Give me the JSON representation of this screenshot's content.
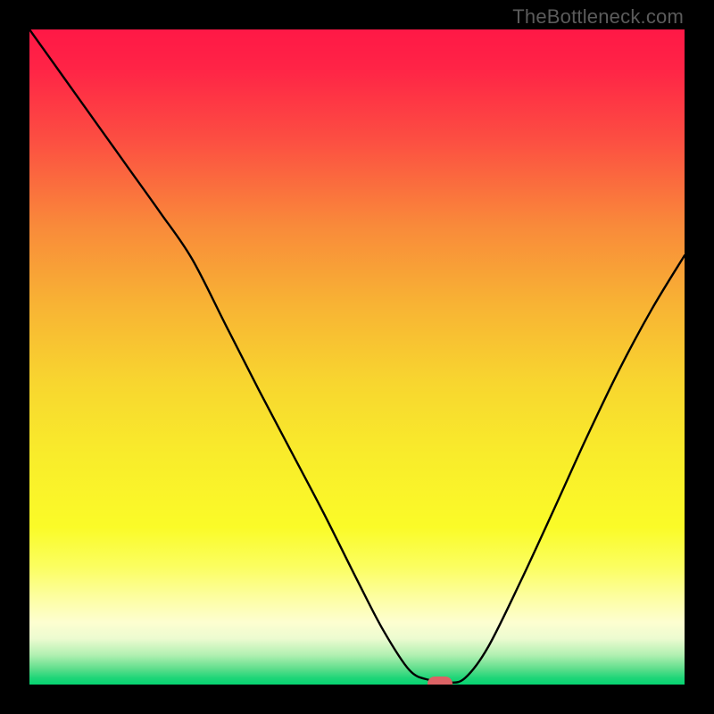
{
  "watermark": "TheBottleneck.com",
  "chart_data": {
    "type": "line",
    "title": "",
    "xlabel": "",
    "ylabel": "",
    "xlim": [
      0,
      1
    ],
    "ylim": [
      0,
      1
    ],
    "grid": false,
    "legend": false,
    "series": [
      {
        "name": "bottleneck-curve",
        "x": [
          0.0,
          0.05,
          0.1,
          0.15,
          0.2,
          0.248,
          0.3,
          0.35,
          0.4,
          0.45,
          0.5,
          0.54,
          0.58,
          0.61,
          0.64,
          0.665,
          0.7,
          0.75,
          0.8,
          0.85,
          0.9,
          0.95,
          1.0
        ],
        "y": [
          1.0,
          0.93,
          0.86,
          0.79,
          0.72,
          0.65,
          0.548,
          0.45,
          0.355,
          0.26,
          0.16,
          0.083,
          0.022,
          0.007,
          0.003,
          0.01,
          0.057,
          0.158,
          0.266,
          0.376,
          0.48,
          0.573,
          0.655
        ]
      }
    ],
    "marker": {
      "x": 0.627,
      "y": 0.002,
      "color": "#dc6365"
    },
    "gradient_stops": [
      {
        "offset": 0.0,
        "color": "#ff1846"
      },
      {
        "offset": 0.06,
        "color": "#ff2446"
      },
      {
        "offset": 0.17,
        "color": "#fc4f42"
      },
      {
        "offset": 0.3,
        "color": "#f98a3a"
      },
      {
        "offset": 0.42,
        "color": "#f8b334"
      },
      {
        "offset": 0.54,
        "color": "#f8d62f"
      },
      {
        "offset": 0.65,
        "color": "#f9ec2b"
      },
      {
        "offset": 0.76,
        "color": "#fafb28"
      },
      {
        "offset": 0.82,
        "color": "#fbfe60"
      },
      {
        "offset": 0.87,
        "color": "#fdfea5"
      },
      {
        "offset": 0.905,
        "color": "#fdfed0"
      },
      {
        "offset": 0.93,
        "color": "#ecfbd0"
      },
      {
        "offset": 0.955,
        "color": "#b1f0b1"
      },
      {
        "offset": 0.975,
        "color": "#63df8e"
      },
      {
        "offset": 0.99,
        "color": "#1ed578"
      },
      {
        "offset": 1.0,
        "color": "#06d471"
      }
    ]
  }
}
